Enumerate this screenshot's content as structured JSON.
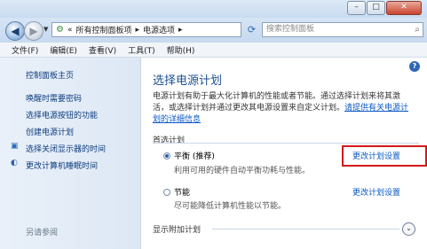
{
  "address": {
    "breadcrumb_sep": "«",
    "segment1": "所有控制面板项",
    "arrow1": "▸",
    "segment2": "电源选项",
    "arrow2": "▸",
    "search_placeholder": "搜索控制面板"
  },
  "menu": [
    "文件(F)",
    "编辑(E)",
    "查看(V)",
    "工具(T)",
    "帮助(H)"
  ],
  "sidebar": {
    "home": "控制面板主页",
    "items": [
      "唤醒时需要密码",
      "选择电源按钮的功能",
      "创建电源计划",
      "选择关闭显示器的时间",
      "更改计算机睡眠时间"
    ],
    "see_also": "另请参阅"
  },
  "main": {
    "title": "选择电源计划",
    "desc_text": "电源计划有助于最大化计算机的性能或者节能。通过选择计划来将其激活，或选择计划并通过更改其电源设置来自定义计划。",
    "desc_link": "请提供有关电源计划的详细信息",
    "preferred_label": "首选计划",
    "plans": [
      {
        "name": "平衡 (推荐)",
        "desc": "利用可用的硬件自动平衡功耗与性能。",
        "link": "更改计划设置",
        "selected": true
      },
      {
        "name": "节能",
        "desc": "尽可能降低计算机性能以节能。",
        "link": "更改计划设置",
        "selected": false
      }
    ],
    "show_more": "显示附加计划"
  },
  "colors": {
    "accent": "#1d4f91",
    "link": "#0a58c4",
    "highlight": "#d41a1a"
  }
}
